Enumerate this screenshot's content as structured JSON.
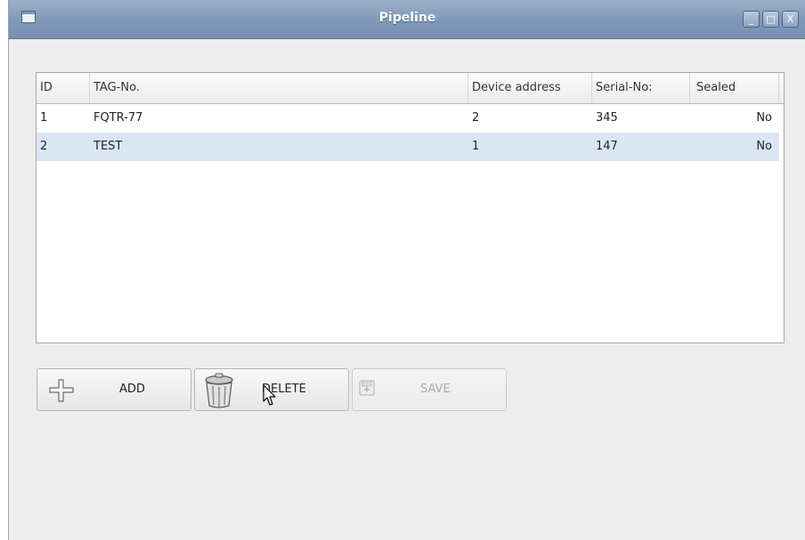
{
  "window": {
    "title": "Pipeline",
    "buttons": {
      "minimize_glyph": "_",
      "maximize_glyph": "□",
      "close_glyph": "X"
    }
  },
  "table": {
    "columns": [
      "ID",
      "TAG-No.",
      "Device address",
      "Serial-No:",
      "Sealed"
    ],
    "rows": [
      {
        "id": "1",
        "tag": "FQTR-77",
        "device_address": "2",
        "serial": "345",
        "sealed": "No",
        "selected": false
      },
      {
        "id": "2",
        "tag": "TEST",
        "device_address": "1",
        "serial": "147",
        "sealed": "No",
        "selected": true
      }
    ]
  },
  "toolbar": {
    "add_label": "ADD",
    "delete_label": "DELETE",
    "save_label": "SAVE",
    "save_enabled": false
  },
  "icons": {
    "window_menu": "window-menu-icon",
    "add": "plus-icon",
    "delete": "trash-can-icon",
    "save": "save-disk-icon",
    "cursor": "mouse-pointer-icon"
  },
  "colors": {
    "titlebar": "#7f98b8",
    "selected_row": "#dbe6f3",
    "window_bg": "#ededed"
  }
}
